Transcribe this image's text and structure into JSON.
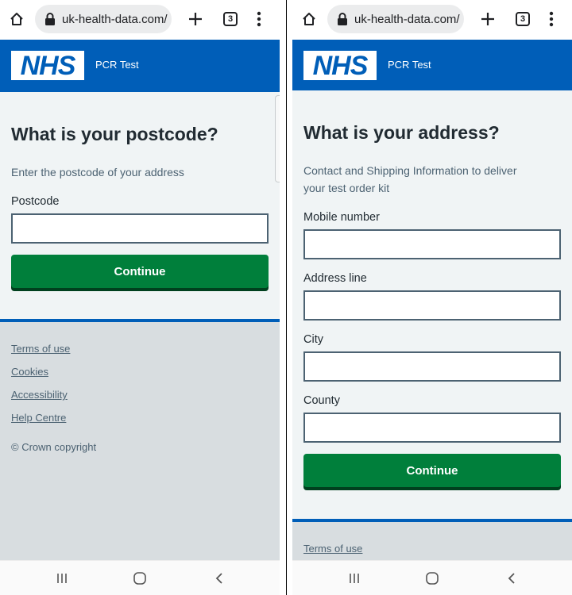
{
  "left": {
    "browser": {
      "url": "uk-health-data.com/",
      "tab_count": "3"
    },
    "header": {
      "logo_text": "NHS",
      "service_name": "PCR Test"
    },
    "page": {
      "heading": "What is your postcode?",
      "hint": "Enter the postcode of your address",
      "postcode_label": "Postcode",
      "postcode_value": "",
      "continue_label": "Continue"
    },
    "footer": {
      "links": [
        "Terms of use",
        "Cookies",
        "Accessibility",
        "Help Centre"
      ],
      "copyright": "© Crown copyright"
    }
  },
  "right": {
    "browser": {
      "url": "uk-health-data.com/",
      "tab_count": "3"
    },
    "header": {
      "logo_text": "NHS",
      "service_name": "PCR Test"
    },
    "page": {
      "heading": "What is your address?",
      "hint_line1": "Contact and Shipping Information to deliver",
      "hint_line2": "your test order kit",
      "mobile_label": "Mobile number",
      "address_label": "Address line",
      "city_label": "City",
      "county_label": "County",
      "continue_label": "Continue"
    },
    "footer": {
      "links": [
        "Terms of use"
      ]
    }
  },
  "colors": {
    "nhs_blue": "#005eb8",
    "button_green": "#007f3b",
    "page_background": "#f0f4f5",
    "footer_background": "#d8dde0",
    "text": "#212b32",
    "secondary_text": "#4c6272"
  },
  "icons": {
    "toolbar": [
      "home-icon",
      "lock-icon",
      "plus-icon",
      "tabs-icon",
      "more-vert-icon"
    ],
    "navbar": [
      "recent-apps-icon",
      "home-circle-icon",
      "back-icon"
    ]
  }
}
